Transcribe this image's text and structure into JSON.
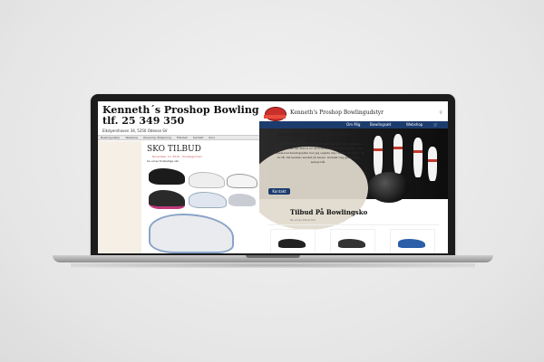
{
  "left_site": {
    "title_line1": "Kenneth´s Proshop Bowling",
    "title_line2": "tlf. 25 349 350",
    "address": "Elkdyershoven 34, 5250 Odense SV",
    "nav": [
      "Bowlingudstyr",
      "Webshop",
      "Personlig rådgivning",
      "Tilbehør",
      "Kontakt",
      "Kurv"
    ],
    "heading": "SKO TILBUD",
    "meta": "November 11, 2019 · Uncategorized",
    "intro": "Se vores forskellige sko"
  },
  "right_site": {
    "site_name": "Kenneth's Proshop Bowlingudstyr",
    "search_icon": "search-icon",
    "nav": [
      "Om Mig",
      "Bowlingsæt",
      "Webshop"
    ],
    "cart_icon": "cart-icon",
    "hero": {
      "heading": "Beskrivelse Af Hjemmesiden",
      "text": "Her er findet du et unikt udvalg af bowlingkugler, sko og tasker, samt alt andet der skal til for at komme i gang med sporten. Som professionel bowlingspiller kan jeg vejlede dig i valget af udstyr, så du får det bedste resultat på banen. Kontakt mig gerne med spørgsmål.",
      "button": "Kontakt"
    },
    "section_title": "Tilbud På Bowlingsko",
    "section_meta": "Se vores tilbud her"
  }
}
